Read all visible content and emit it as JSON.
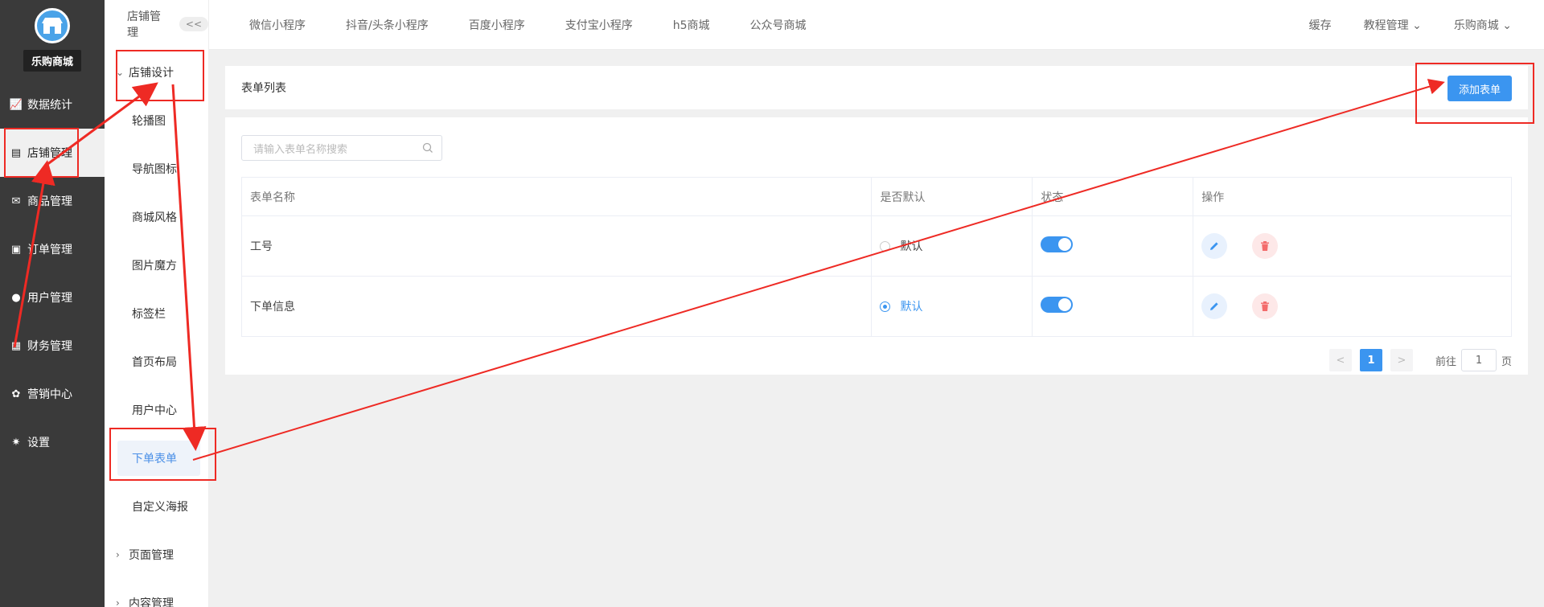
{
  "brand": {
    "name": "乐购商城"
  },
  "sidebar": {
    "items": [
      {
        "label": "数据统计",
        "icon": "chart-icon"
      },
      {
        "label": "店铺管理",
        "icon": "store-icon"
      },
      {
        "label": "商品管理",
        "icon": "bag-icon"
      },
      {
        "label": "订单管理",
        "icon": "clipboard-icon"
      },
      {
        "label": "用户管理",
        "icon": "user-icon"
      },
      {
        "label": "财务管理",
        "icon": "wallet-icon"
      },
      {
        "label": "营销中心",
        "icon": "marketing-icon"
      },
      {
        "label": "设置",
        "icon": "gear-icon"
      }
    ]
  },
  "submenu": {
    "header": "店铺管理",
    "collapse_label": "<<",
    "group_open": "店铺设计",
    "items": [
      "轮播图",
      "导航图标",
      "商城风格",
      "图片魔方",
      "标签栏",
      "首页布局",
      "用户中心",
      "下单表单",
      "自定义海报"
    ],
    "group_closed_1": "页面管理",
    "group_closed_2": "内容管理"
  },
  "topnav": {
    "tabs": [
      "微信小程序",
      "抖音/头条小程序",
      "百度小程序",
      "支付宝小程序",
      "h5商城",
      "公众号商城"
    ],
    "right": {
      "cache": "缓存",
      "tutorial": "教程管理",
      "store": "乐购商城"
    }
  },
  "page": {
    "title": "表单列表",
    "add_button": "添加表单",
    "search_placeholder": "请输入表单名称搜索"
  },
  "table": {
    "headers": [
      "表单名称",
      "是否默认",
      "状态",
      "操作"
    ],
    "rows": [
      {
        "name": "工号",
        "default_label": "默认",
        "is_default": false,
        "enabled": true
      },
      {
        "name": "下单信息",
        "default_label": "默认",
        "is_default": true,
        "enabled": true
      }
    ]
  },
  "pagination": {
    "prev": "<",
    "current": "1",
    "next": ">",
    "goto_label": "前往",
    "page_value": "1",
    "page_unit": "页"
  },
  "colors": {
    "accent": "#3b95f0",
    "annotation": "#ee2a24"
  }
}
